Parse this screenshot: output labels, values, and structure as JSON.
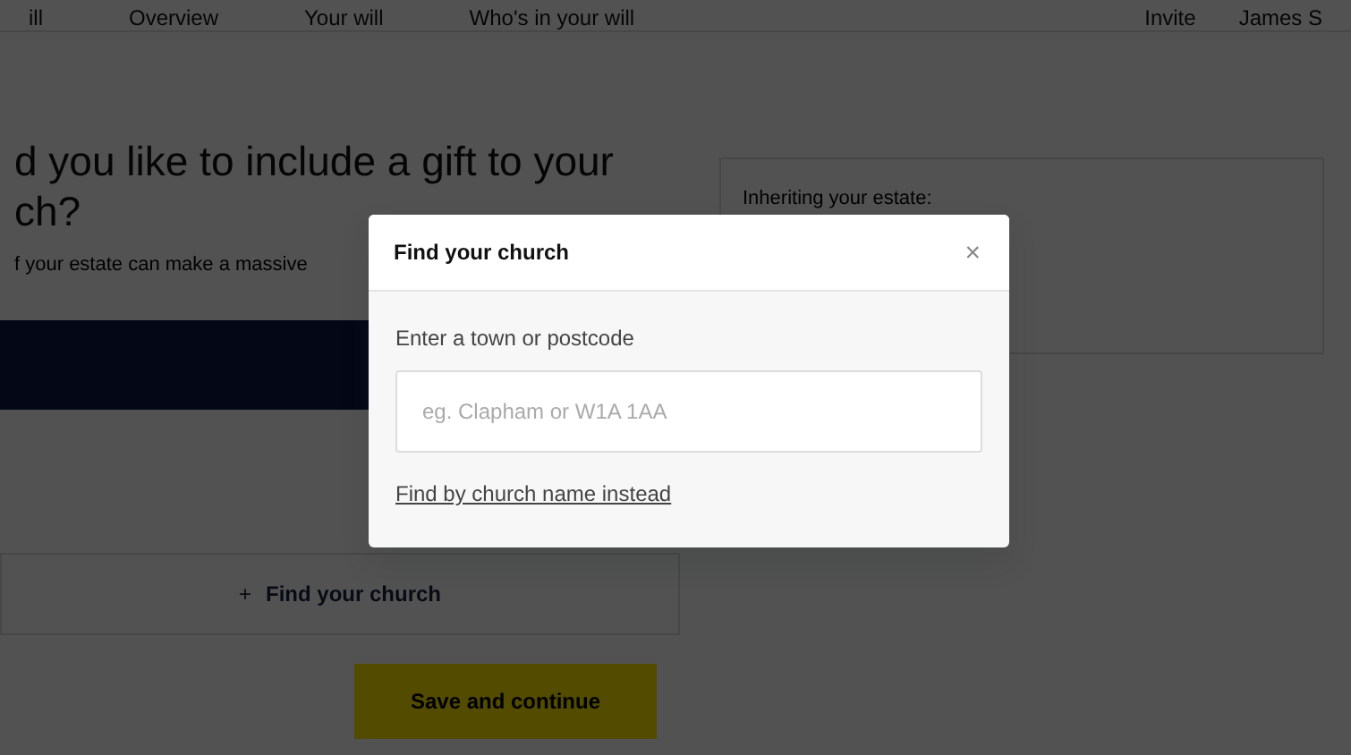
{
  "nav": {
    "items": [
      "ill",
      "Overview",
      "Your will",
      "Who's in your will"
    ],
    "right_items": [
      "Invite",
      "James S"
    ]
  },
  "page": {
    "heading_lines": [
      "d you like to include a gift to your",
      "ch?"
    ],
    "subtitle": "f your estate can make a massive",
    "find_church": {
      "icon": "+",
      "label": "Find your church"
    },
    "save_button": "Save and continue"
  },
  "sidebar": {
    "title": "Inheriting your estate:"
  },
  "modal": {
    "title": "Find your church",
    "close": "×",
    "field_label": "Enter a town or postcode",
    "field": {
      "placeholder": "eg. Clapham or W1A 1AA"
    },
    "link": "Find by church name instead"
  }
}
